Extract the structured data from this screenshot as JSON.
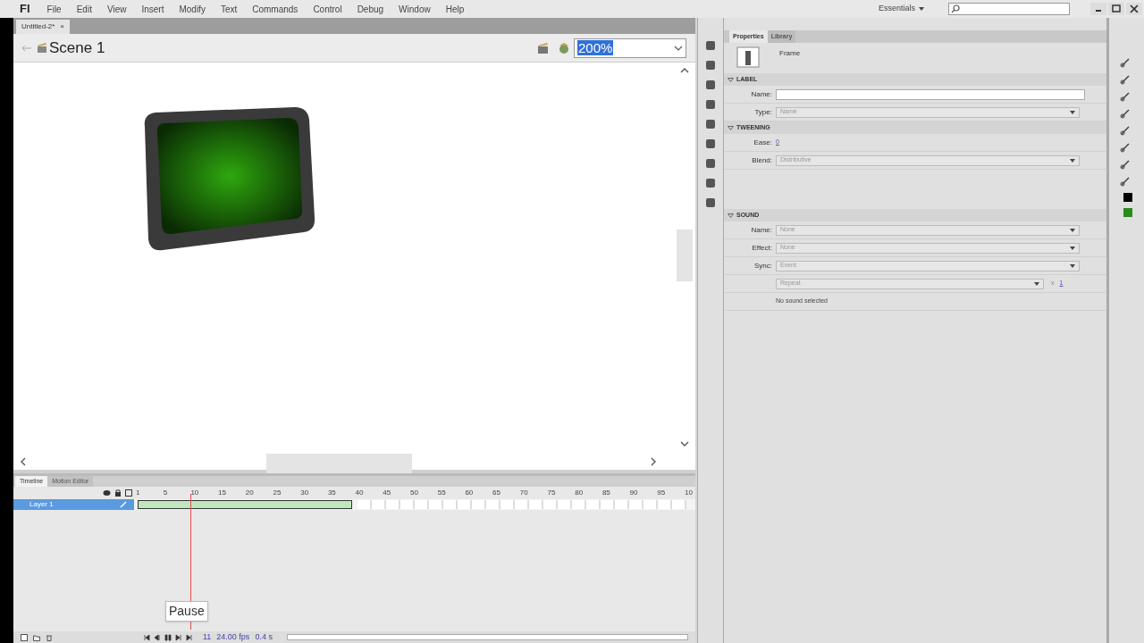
{
  "app": {
    "logo": "Fl",
    "menu": [
      "File",
      "Edit",
      "View",
      "Insert",
      "Modify",
      "Text",
      "Commands",
      "Control",
      "Debug",
      "Window",
      "Help"
    ],
    "workspace": "Essentials"
  },
  "document_tabs": [
    {
      "label": "Untitled-2*",
      "close": "×",
      "selected": true
    }
  ],
  "edit_bar": {
    "scene": "Scene 1",
    "zoom": "200%"
  },
  "timeline": {
    "tabs": [
      {
        "label": "Timeline",
        "selected": true
      },
      {
        "label": "Motion Editor",
        "selected": false
      }
    ],
    "ticks": [
      "1",
      "5",
      "10",
      "15",
      "20",
      "25",
      "30",
      "35",
      "40",
      "45",
      "50",
      "55",
      "60",
      "65",
      "70",
      "75",
      "80",
      "85",
      "90",
      "95",
      "10"
    ],
    "layers": [
      {
        "name": "Layer 1",
        "selected": true
      }
    ],
    "tooltip": "Pause",
    "status": [
      "11",
      "24.00 fps",
      "0.4 s"
    ]
  },
  "properties": {
    "tabs": [
      {
        "label": "Properties",
        "selected": true
      },
      {
        "label": "Library",
        "selected": false
      }
    ],
    "object": "Frame",
    "sections": [
      {
        "title": "LABEL",
        "rows": [
          {
            "kind": "input",
            "label": "Name:"
          },
          {
            "kind": "select",
            "label": "Type:",
            "value": "Name"
          }
        ]
      },
      {
        "title": "TWEENING",
        "rows": [
          {
            "kind": "link",
            "label": "Ease:",
            "value": "0"
          },
          {
            "kind": "select",
            "label": "Blend:",
            "value": "Distributive"
          }
        ]
      },
      {
        "title": "SOUND",
        "rows": [
          {
            "kind": "select",
            "label": "Name:",
            "value": "None"
          },
          {
            "kind": "select",
            "label": "Effect:",
            "value": "None"
          },
          {
            "kind": "select",
            "label": "Sync:",
            "value": "Event"
          },
          {
            "kind": "select",
            "label": "",
            "value": "Repeat",
            "suffix": "x",
            "count": "1"
          },
          {
            "kind": "note",
            "value": "No sound selected"
          }
        ]
      }
    ]
  }
}
